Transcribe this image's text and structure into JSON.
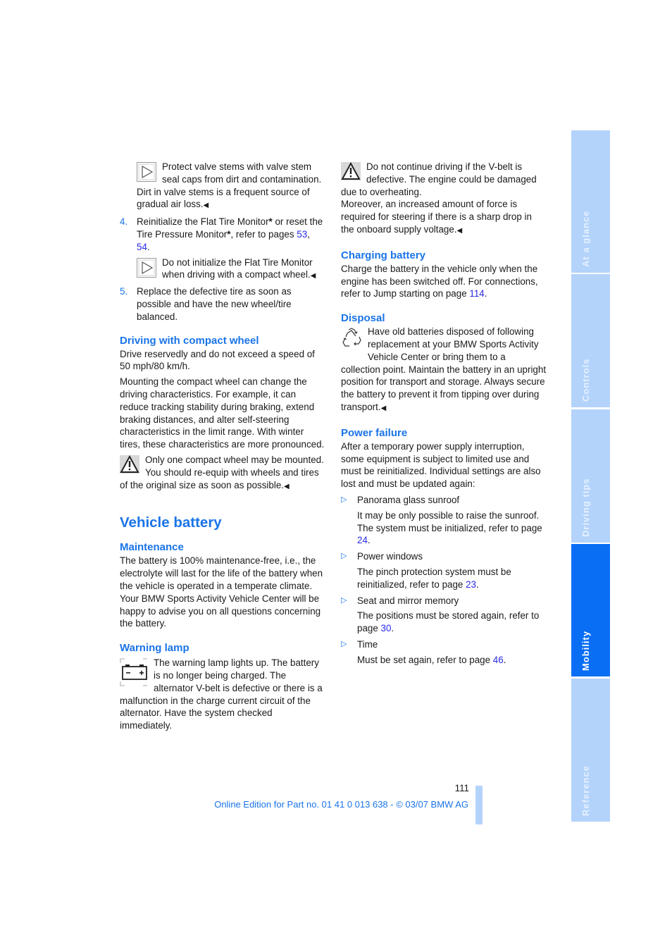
{
  "left_column": {
    "note_valve": "Protect valve stems with valve stem seal caps from dirt and contamination. Dirt in valve stems is a frequent source of gradual air loss.",
    "step4": {
      "num": "4.",
      "text_a": "Reinitialize the Flat Tire Monitor",
      "star": "*",
      "text_b": " or reset the Tire Pressure Monitor",
      "text_c": ", refer to pages ",
      "link1": "53",
      "sep": ", ",
      "link2": "54",
      "end": "."
    },
    "note_flat": "Do not initialize the Flat Tire Monitor when driving with a compact wheel.",
    "step5": {
      "num": "5.",
      "text": "Replace the defective tire as soon as possible and have the new wheel/tire balanced."
    },
    "compact_heading": "Driving with compact wheel",
    "compact_p1": "Drive reservedly and do not exceed a speed of 50 mph/80 km/h.",
    "compact_p2": "Mounting the compact wheel can change the driving characteristics. For example, it can reduce tracking stability during braking, extend braking distances, and alter self-steering characteristics in the limit range. With winter tires, these characteristics are more pronounced.",
    "compact_warning": "Only one compact wheel may be mounted. You should re-equip with wheels and tires of the original size as soon as possible.",
    "battery_title": "Vehicle battery",
    "maintenance_heading": "Maintenance",
    "maintenance_text": "The battery is 100% maintenance-free, i.e., the electrolyte will last for the life of the battery when the vehicle is operated in a temperate climate. Your BMW Sports Activity Vehicle Center will be happy to advise you on all questions concerning the battery.",
    "warning_lamp_heading": "Warning lamp",
    "warning_lamp_text": "The warning lamp lights up. The battery is no longer being charged. The alternator V-belt is defective or there is a malfunction in the charge current circuit of the alternator. Have the system checked immediately."
  },
  "right_column": {
    "vbelt_warning_a": "Do not continue driving if the V-belt is defective. The engine could be damaged due to overheating.",
    "vbelt_warning_b": "Moreover, an increased amount of force is required for steering if there is a sharp drop in the onboard supply voltage.",
    "charging_heading": "Charging battery",
    "charging_text": "Charge the battery in the vehicle only when the engine has been switched off. For connections, refer to Jump starting on page ",
    "charging_link": "114",
    "disposal_heading": "Disposal",
    "disposal_text": "Have old batteries disposed of following replacement at your BMW Sports Activity Vehicle Center or bring them to a collection point. Maintain the battery in an upright position for transport and storage. Always secure the battery to prevent it from tipping over during transport.",
    "power_heading": "Power failure",
    "power_text": "After a temporary power supply interruption, some equipment is subject to limited use and must be reinitialized. Individual settings are also lost and must be updated again:",
    "power_items": [
      {
        "title": "Panorama glass sunroof",
        "desc": "It may be only possible to raise the sunroof. The system must be initialized, refer to page ",
        "link": "24"
      },
      {
        "title": "Power windows",
        "desc": "The pinch protection system must be reinitialized, refer to page ",
        "link": "23"
      },
      {
        "title": "Seat and mirror memory",
        "desc": "The positions must be stored again, refer to page ",
        "link": "30"
      },
      {
        "title": "Time",
        "desc": "Must be set again, refer to page ",
        "link": "46"
      }
    ]
  },
  "side_tabs": [
    {
      "label": "At a glance",
      "active": false
    },
    {
      "label": "Controls",
      "active": false
    },
    {
      "label": "Driving tips",
      "active": false
    },
    {
      "label": "Mobility",
      "active": true
    },
    {
      "label": "Reference",
      "active": false
    }
  ],
  "footer": {
    "page_number": "111",
    "edition": "Online Edition for Part no. 01 41 0 013 638 - © 03/07 BMW AG"
  },
  "symbols": {
    "end_mark": "◀",
    "bullet": "▷",
    "period": "."
  },
  "colors": {
    "accent": "#1a74e8",
    "link": "#2a2ae8",
    "tab_inactive": "#b3d3fb",
    "tab_active": "#0a6ef5"
  }
}
